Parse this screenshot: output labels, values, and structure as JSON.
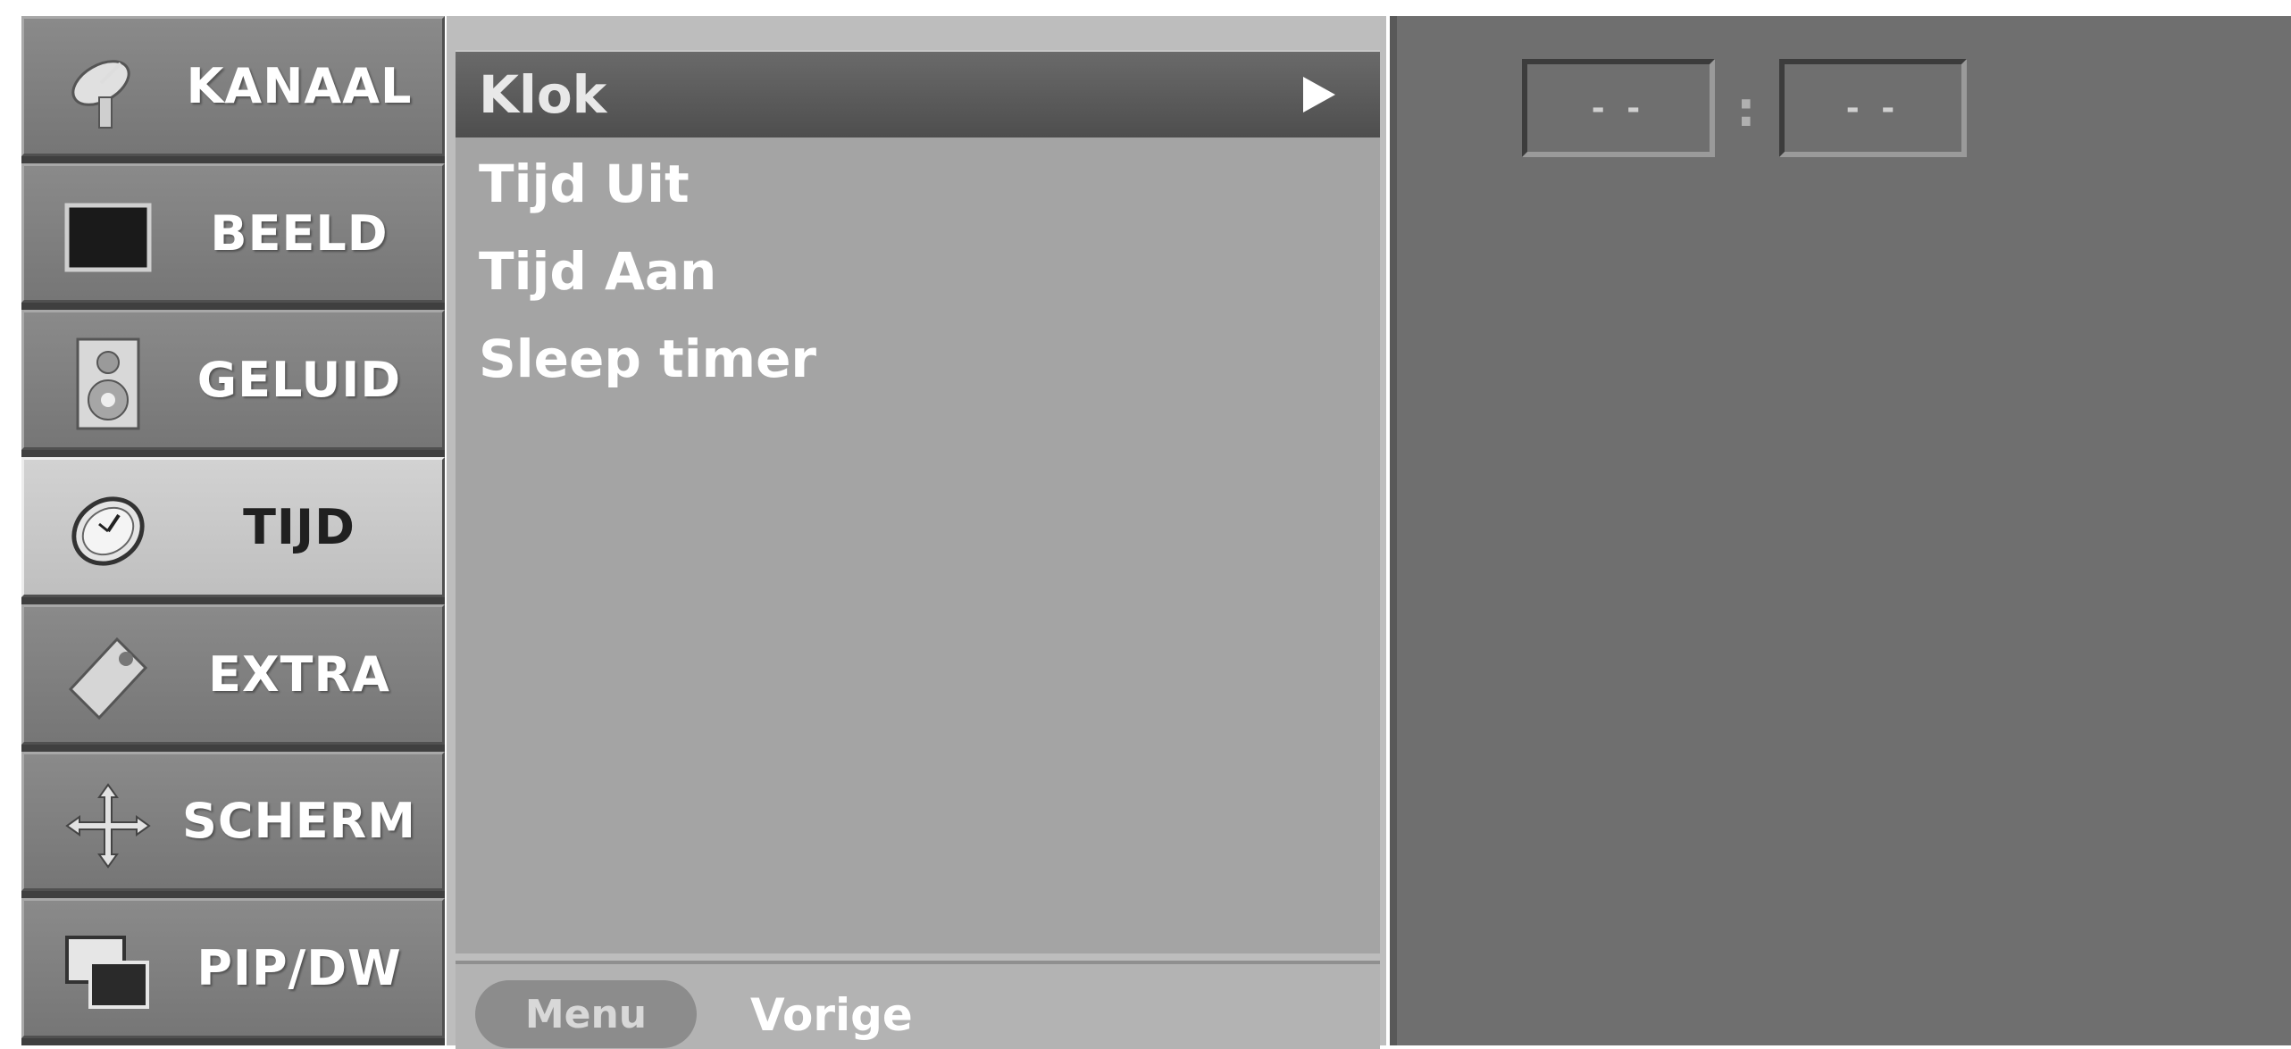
{
  "sidebar": {
    "items": [
      {
        "label": "KANAAL",
        "icon": "satellite-dish-icon"
      },
      {
        "label": "BEELD",
        "icon": "screen-icon"
      },
      {
        "label": "GELUID",
        "icon": "speaker-icon"
      },
      {
        "label": "TIJD",
        "icon": "clock-icon",
        "active": true
      },
      {
        "label": "EXTRA",
        "icon": "tag-icon"
      },
      {
        "label": "SCHERM",
        "icon": "move-arrows-icon"
      },
      {
        "label": "PIP/DW",
        "icon": "pip-windows-icon"
      }
    ]
  },
  "menu": {
    "items": [
      {
        "label": "Klok",
        "selected": true
      },
      {
        "label": "Tijd Uit"
      },
      {
        "label": "Tijd Aan"
      },
      {
        "label": "Sleep timer"
      }
    ]
  },
  "footer": {
    "menu_key": "Menu",
    "back_label": "Vorige"
  },
  "clock": {
    "hours": "- -",
    "separator": ":",
    "minutes": "- -"
  }
}
